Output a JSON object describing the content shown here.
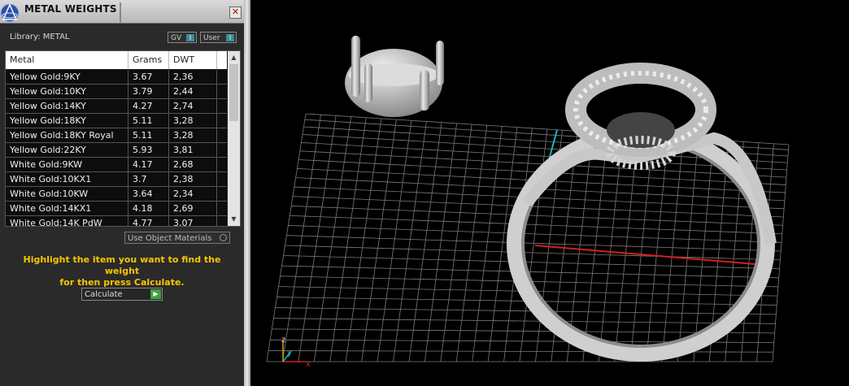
{
  "panel": {
    "title": "METAL WEIGHTS",
    "close_label": "✕",
    "library_label": "Library: METAL",
    "toggle_gv_label": "GV",
    "toggle_user_label": "User",
    "toggle_mark": "I",
    "table": {
      "headers": [
        "Metal",
        "Grams",
        "DWT"
      ],
      "rows": [
        [
          "Yellow Gold:9KY",
          "3.67",
          "2,36"
        ],
        [
          "Yellow Gold:10KY",
          "3.79",
          "2,44"
        ],
        [
          "Yellow Gold:14KY",
          "4.27",
          "2,74"
        ],
        [
          "Yellow Gold:18KY",
          "5.11",
          "3,28"
        ],
        [
          "Yellow Gold:18KY Royal",
          "5.11",
          "3,28"
        ],
        [
          "Yellow Gold:22KY",
          "5.93",
          "3,81"
        ],
        [
          "White Gold:9KW",
          "4.17",
          "2,68"
        ],
        [
          "White Gold:10KX1",
          "3.7",
          "2,38"
        ],
        [
          "White Gold:10KW",
          "3.64",
          "2,34"
        ],
        [
          "White Gold:14KX1",
          "4.18",
          "2,69"
        ],
        [
          "White Gold:14K PdW",
          "4.77",
          "3,07"
        ]
      ]
    },
    "use_object_materials_label": "Use Object Materials",
    "instruction_line1": "Highlight the item you want to find the weight",
    "instruction_line2": "for then press Calculate.",
    "calculate_label": "Calculate",
    "calculate_arrow": "▶"
  },
  "viewport": {
    "axis_z_label": "z",
    "axis_y_label": "y",
    "axis_x_label": "x",
    "colors": {
      "axis_x": "#d02020",
      "axis_y": "#20b0c0",
      "grid": "#7a7a7a",
      "model": "#cfcfcf"
    }
  },
  "icons": [
    "app-logo-icon",
    "close-icon",
    "scroll-up-icon",
    "scroll-down-icon",
    "radio-icon",
    "play-arrow-icon"
  ]
}
